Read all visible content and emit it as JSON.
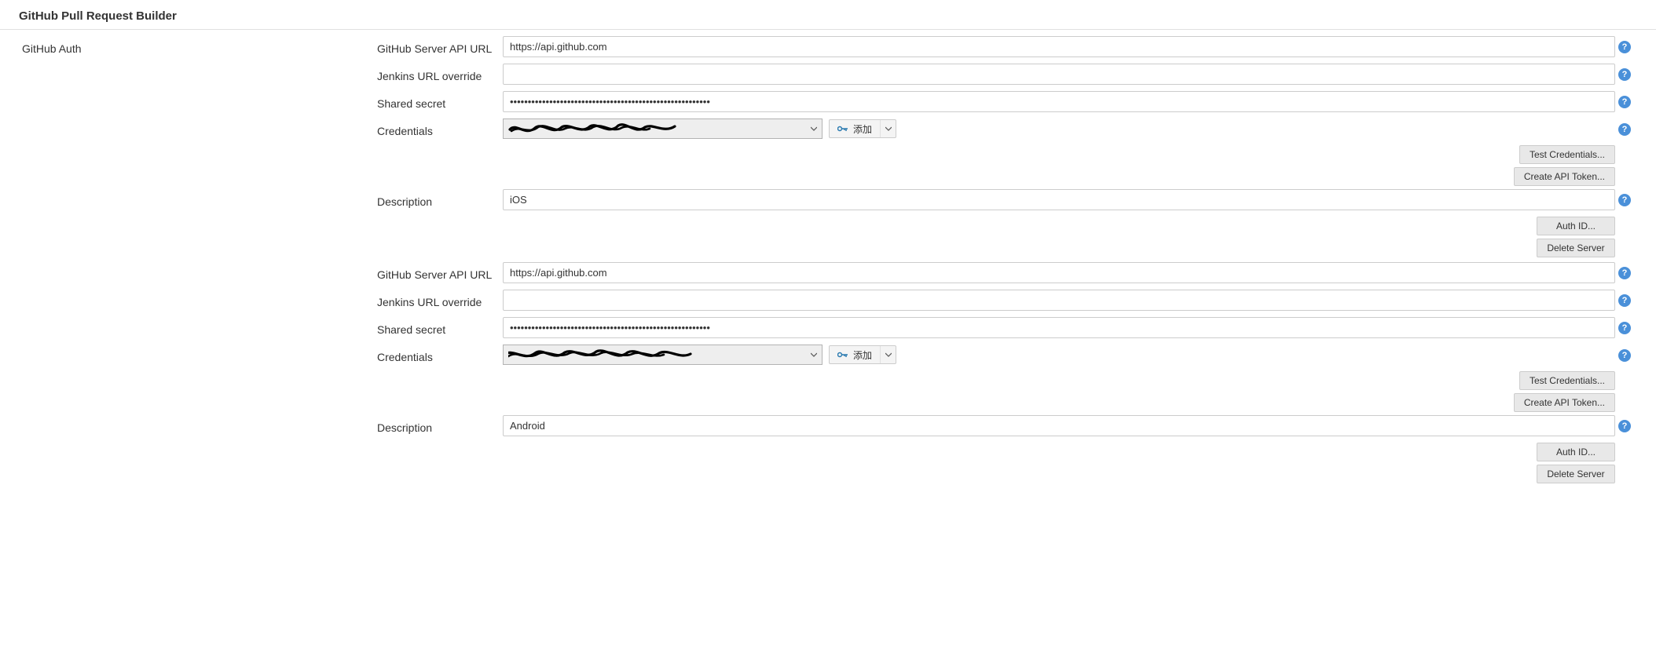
{
  "header": {
    "title": "GitHub Pull Request Builder"
  },
  "sidebar": {
    "label": "GitHub Auth"
  },
  "labels": {
    "api_url": "GitHub Server API URL",
    "jenkins_override": "Jenkins URL override",
    "shared_secret": "Shared secret",
    "credentials": "Credentials",
    "description": "Description",
    "add_button": "添加",
    "test_credentials": "Test Credentials...",
    "create_api_token": "Create API Token...",
    "auth_id": "Auth ID...",
    "delete_server": "Delete Server"
  },
  "servers": [
    {
      "api_url": "https://api.github.com",
      "jenkins_override": "",
      "shared_secret": "••••••••••••••••••••••••••••••••••••••••••••••••••••••••",
      "credentials_display": "(redacted)",
      "description": "iOS"
    },
    {
      "api_url": "https://api.github.com",
      "jenkins_override": "",
      "shared_secret": "••••••••••••••••••••••••••••••••••••••••••••••••••••••••",
      "credentials_display": "(redacted)",
      "description": "Android"
    }
  ]
}
